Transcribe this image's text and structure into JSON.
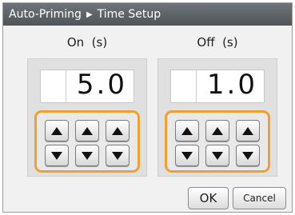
{
  "title": {
    "section": "Auto-Priming",
    "separator": "▶",
    "page": "Time Setup"
  },
  "on": {
    "label": "On  (s)",
    "value": "5.0"
  },
  "off": {
    "label": "Off  (s)",
    "value": "1.0"
  },
  "buttons": {
    "ok": "OK",
    "cancel": "Cancel"
  },
  "colors": {
    "titlebar": "#5c6165",
    "highlight": "#f0a030",
    "background": "#f1f1f1"
  },
  "icons": {
    "up": "triangle-up-icon",
    "down": "triangle-down-icon"
  }
}
